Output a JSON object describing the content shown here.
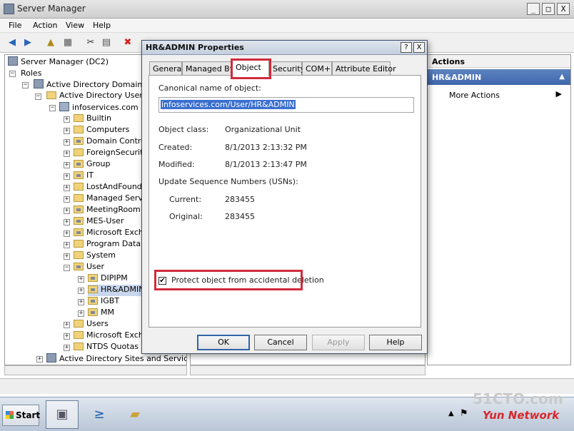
{
  "window": {
    "title": "Server Manager",
    "min": "_",
    "max": "□",
    "close": "X"
  },
  "menu": [
    "File",
    "Action",
    "View",
    "Help"
  ],
  "toolbar": {
    "icons": [
      "back-icon",
      "forward-icon",
      "up-folder-icon",
      "show-tree-icon",
      "cut-icon",
      "paste-icon",
      "delete-icon"
    ]
  },
  "tree": {
    "root": "Server Manager (DC2)",
    "roles": "Roles",
    "adds": "Active Directory Domain Se",
    "aduc": "Active Directory Users a",
    "domain": "infoservices.com",
    "children": [
      "Builtin",
      "Computers",
      "Domain Control",
      "ForeignSecurity",
      "Group",
      "IT",
      "LostAndFound",
      "Managed Servic",
      "MeetingRoom",
      "MES-User",
      "Microsoft Excha",
      "Program Data",
      "System",
      "User"
    ],
    "user_children": [
      "DIPIPM",
      "HR&ADMIN",
      "IGBT",
      "MM"
    ],
    "after": [
      "Users",
      "Microsoft Excha",
      "NTDS Quotas"
    ],
    "sites": "Active Directory Sites and Services"
  },
  "actions": {
    "header": "Actions",
    "section": "HR&ADMIN",
    "more": "More Actions"
  },
  "dialog": {
    "title": "HR&ADMIN Properties",
    "help": "?",
    "close": "X",
    "tabs": [
      "General",
      "Managed By",
      "Object",
      "Security",
      "COM+",
      "Attribute Editor"
    ],
    "canonical_label": "Canonical name of object:",
    "canonical_value": "infoservices.com/User/HR&ADMIN",
    "object_class_label": "Object class:",
    "object_class_value": "Organizational Unit",
    "created_label": "Created:",
    "created_value": "8/1/2013 2:13:32 PM",
    "modified_label": "Modified:",
    "modified_value": "8/1/2013 2:13:47 PM",
    "usn_label": "Update Sequence Numbers (USNs):",
    "current_label": "Current:",
    "current_value": "283455",
    "original_label": "Original:",
    "original_value": "283455",
    "protect_label": "Protect object from accidental deletion",
    "protect_checked": "✔",
    "buttons": {
      "ok": "OK",
      "cancel": "Cancel",
      "apply": "Apply",
      "help": "Help"
    }
  },
  "taskbar": {
    "start": "Start"
  },
  "watermark": {
    "line1": "51CTO.com",
    "line2": "Yun Network"
  }
}
